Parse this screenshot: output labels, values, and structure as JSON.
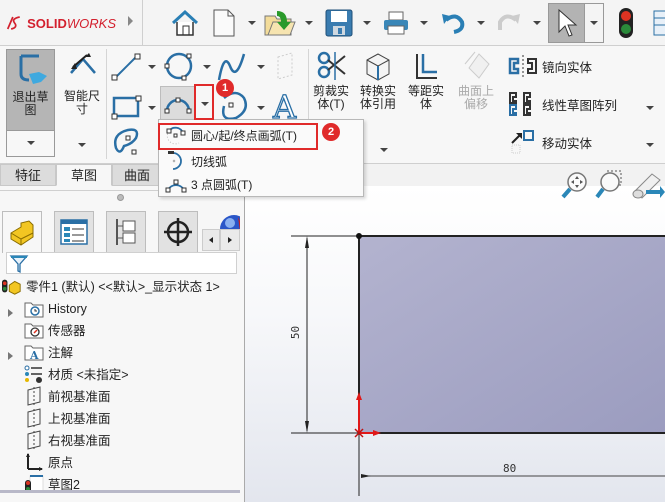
{
  "app": {
    "brand_prefix": "SOLID",
    "brand_suffix": "WORKS"
  },
  "quick_access": {
    "items": [
      "home",
      "new",
      "open",
      "save",
      "print",
      "undo",
      "redo",
      "select",
      "rebuild"
    ]
  },
  "ribbon": {
    "exit_sketch": "退出草\n图",
    "exit_sketch_l1": "退出草",
    "exit_sketch_l2": "图",
    "smart_dim_l1": "智能尺",
    "smart_dim_l2": "寸",
    "trim_l1": "剪裁实",
    "trim_l2": "体(T)",
    "convert_l1": "转换实",
    "convert_l2": "体引用",
    "offset_l1": "等距实",
    "offset_l2": "体",
    "surface_offset_l1": "曲面上",
    "surface_offset_l2": "偏移",
    "mirror": "镜向实体",
    "linear_pattern": "线性草图阵列",
    "move": "移动实体"
  },
  "tabs": [
    {
      "label": "特征",
      "active": false
    },
    {
      "label": "草图",
      "active": true
    },
    {
      "label": "曲面",
      "active": false
    }
  ],
  "arc_dropdown": {
    "items": [
      {
        "label": "圆心/起/终点画弧(T)",
        "highlighted": true
      },
      {
        "label": "切线弧",
        "highlighted": false
      },
      {
        "label": "3 点圆弧(T)",
        "highlighted": false
      }
    ]
  },
  "annotations": {
    "badge1": "1",
    "badge2": "2",
    "color": "#e02a2a"
  },
  "feature_tree": {
    "root": "零件1 (默认) <<默认>_显示状态 1>",
    "items": [
      {
        "label": "History",
        "expandable": true,
        "icon": "history-folder-icon"
      },
      {
        "label": "传感器",
        "expandable": false,
        "icon": "sensor-folder-icon"
      },
      {
        "label": "注解",
        "expandable": true,
        "icon": "annotation-folder-icon"
      },
      {
        "label": "材质 <未指定>",
        "expandable": false,
        "icon": "material-icon"
      },
      {
        "label": "前视基准面",
        "expandable": false,
        "icon": "plane-icon"
      },
      {
        "label": "上视基准面",
        "expandable": false,
        "icon": "plane-icon"
      },
      {
        "label": "右视基准面",
        "expandable": false,
        "icon": "plane-icon"
      },
      {
        "label": "原点",
        "expandable": false,
        "icon": "origin-icon"
      },
      {
        "label": "草图2",
        "expandable": false,
        "icon": "sketch-icon"
      }
    ]
  },
  "sketch": {
    "dim_height": "50",
    "dim_width": "80",
    "fill_color": "#a9aac6"
  }
}
